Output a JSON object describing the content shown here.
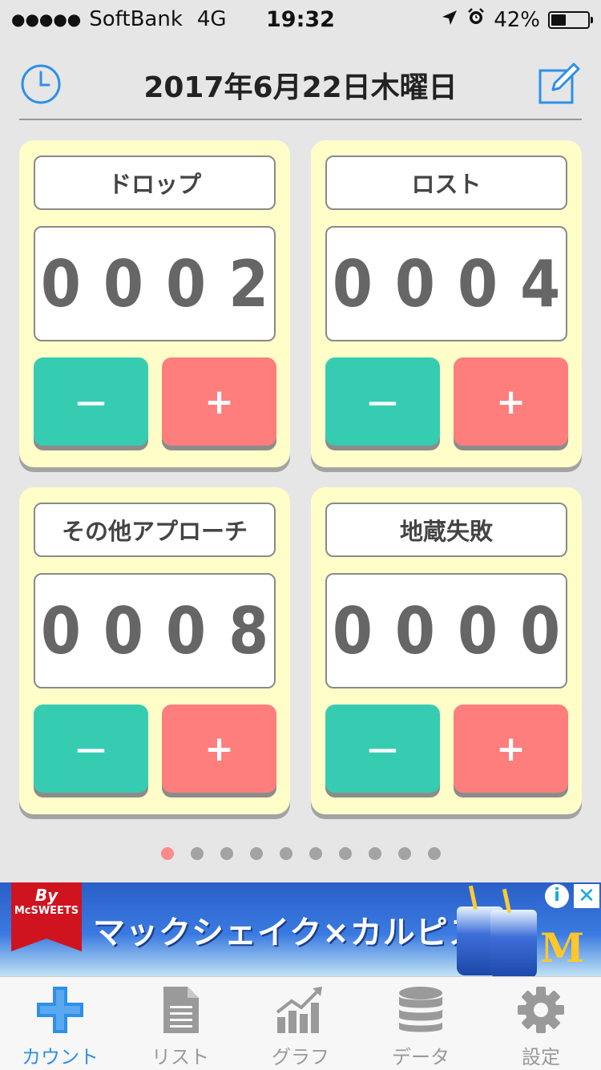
{
  "status_bar": {
    "signal": "●●●●●",
    "carrier": "SoftBank",
    "network": "4G",
    "time": "19:32",
    "battery": "42%",
    "battery_level": 0.42
  },
  "header": {
    "date": "2017年6月22日木曜日",
    "history_icon": "clock-icon",
    "edit_icon": "edit-icon"
  },
  "counters": [
    {
      "label": "ドロップ",
      "count": "0002",
      "minus_label": "－",
      "plus_label": "+"
    },
    {
      "label": "ロスト",
      "count": "0004",
      "minus_label": "－",
      "plus_label": "+"
    },
    {
      "label": "その他アプローチ",
      "count": "0008",
      "minus_label": "－",
      "plus_label": "+"
    },
    {
      "label": "地蔵失敗",
      "count": "0000",
      "minus_label": "－",
      "plus_label": "+"
    }
  ],
  "pager": {
    "total_pages": 10,
    "current_page": 1
  },
  "ad": {
    "brand": "McSWEETS",
    "brand_prefix": "By",
    "headline": "マックシェイク×カルピス",
    "info_label": "i",
    "close_label": "✕"
  },
  "tab_bar": {
    "tabs": [
      {
        "label": "カウント",
        "icon": "plus-icon",
        "active": true
      },
      {
        "label": "リスト",
        "icon": "document-icon",
        "active": false
      },
      {
        "label": "グラフ",
        "icon": "chart-icon",
        "active": false
      },
      {
        "label": "データ",
        "icon": "database-icon",
        "active": false
      },
      {
        "label": "設定",
        "icon": "gear-icon",
        "active": false
      }
    ]
  },
  "colors": {
    "background": "#e6e6e6",
    "card": "#fffdc8",
    "minus_button": "#36ccb2",
    "plus_button": "#fd7e7d",
    "accent": "#2f8fe9"
  }
}
